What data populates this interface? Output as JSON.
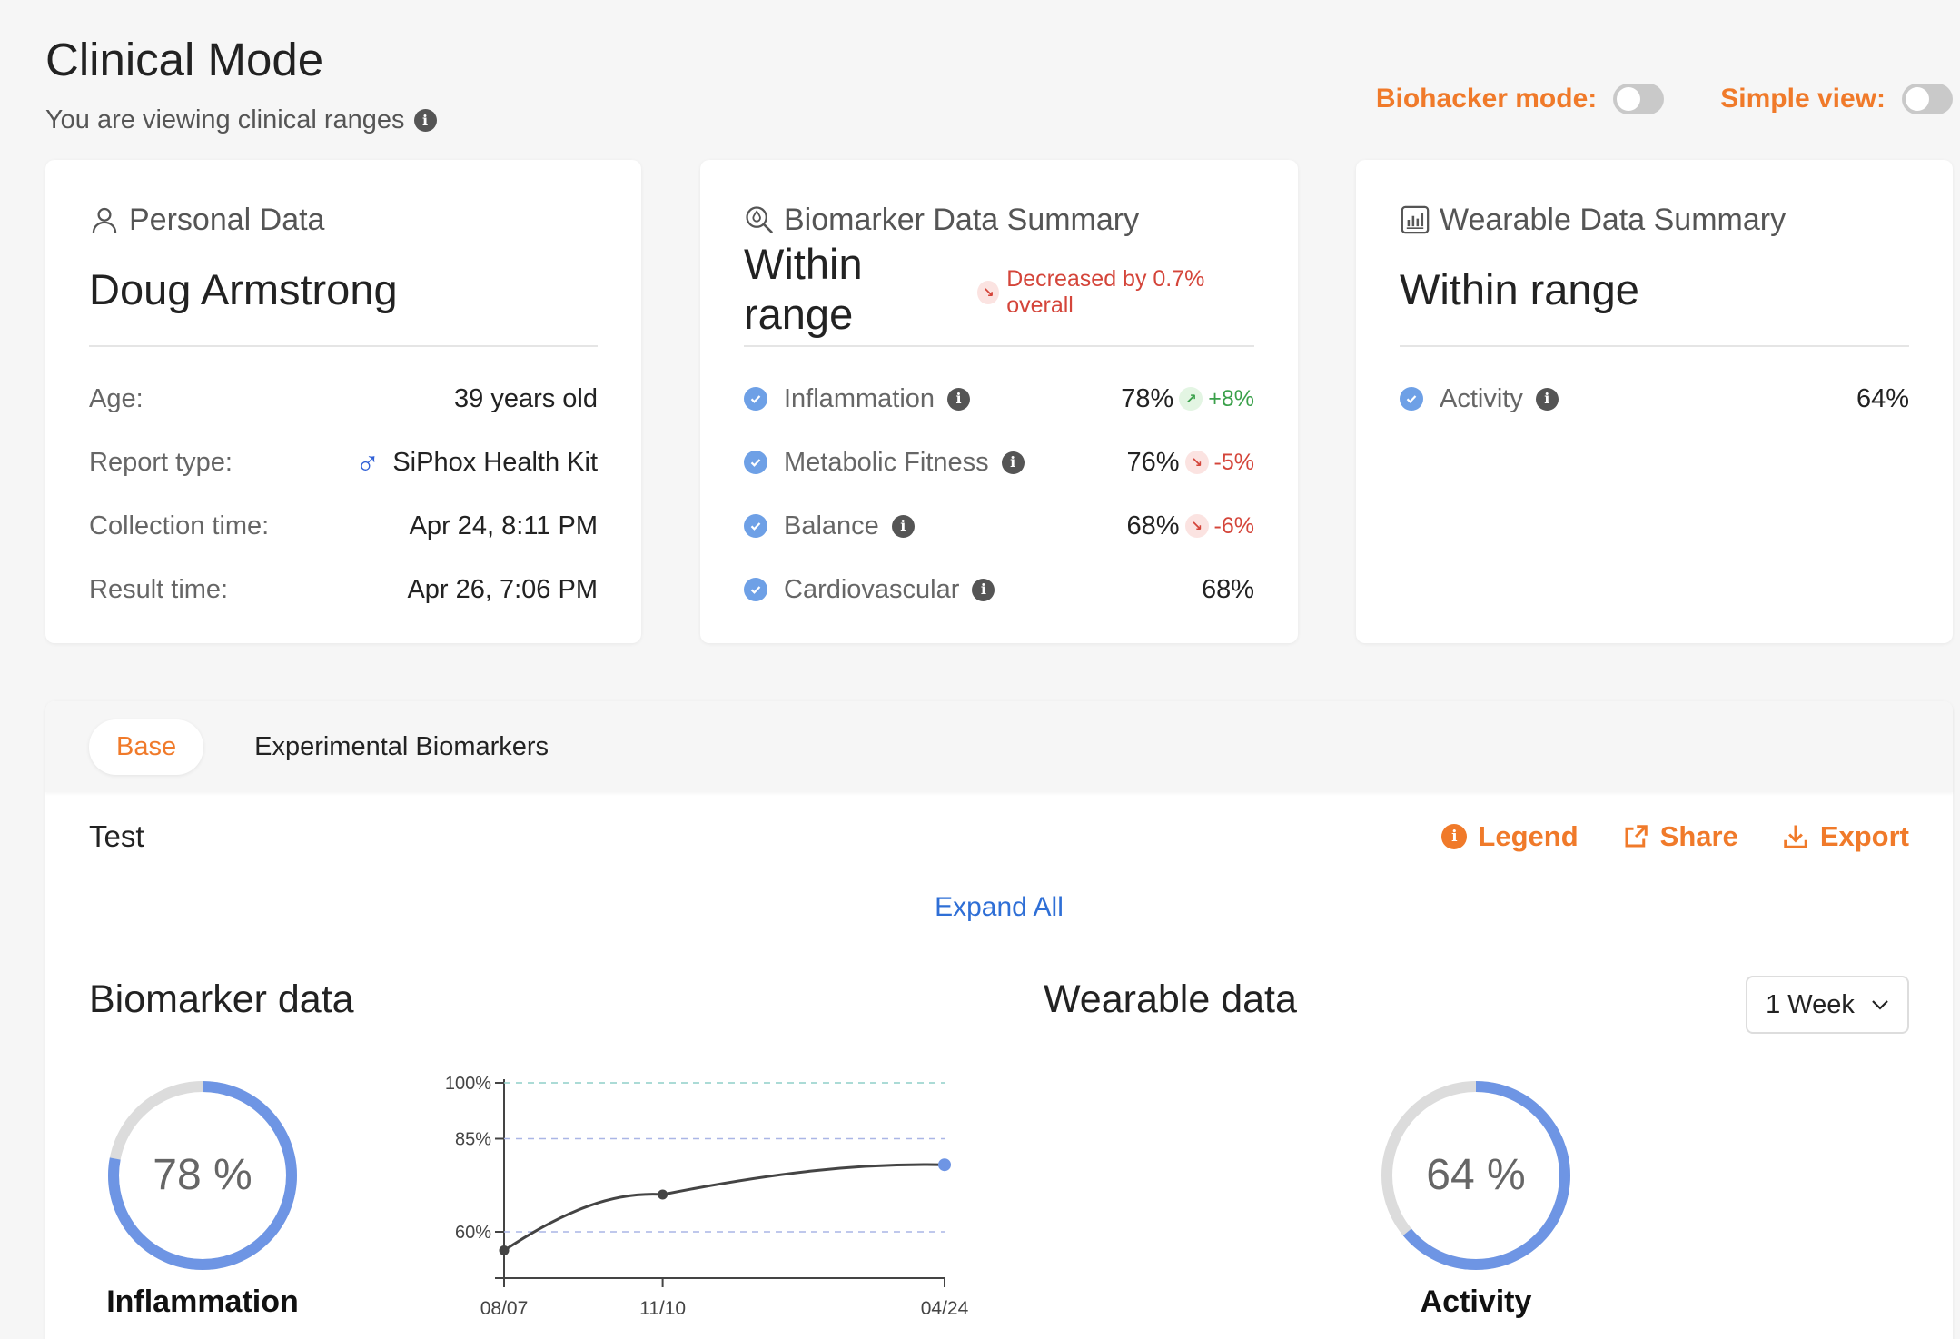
{
  "header": {
    "title": "Clinical Mode",
    "subtitle": "You are viewing clinical ranges",
    "biohacker_label": "Biohacker mode:",
    "simple_label": "Simple view:"
  },
  "personal": {
    "title": "Personal Data",
    "name": "Doug Armstrong",
    "rows": [
      {
        "k": "Age:",
        "v": "39 years old"
      },
      {
        "k": "Report type:",
        "v": "SiPhox Health Kit"
      },
      {
        "k": "Collection time:",
        "v": "Apr 24, 8:11 PM"
      },
      {
        "k": "Result time:",
        "v": "Apr 26, 7:06 PM"
      }
    ]
  },
  "biomarker_summary": {
    "title": "Biomarker Data Summary",
    "status": "Within range",
    "change": "Decreased by 0.7% overall",
    "rows": [
      {
        "k": "Inflammation",
        "v": "78%",
        "delta": "+8%"
      },
      {
        "k": "Metabolic Fitness",
        "v": "76%",
        "delta": "-5%"
      },
      {
        "k": "Balance",
        "v": "68%",
        "delta": "-6%"
      },
      {
        "k": "Cardiovascular",
        "v": "68%"
      }
    ]
  },
  "wearable_summary": {
    "title": "Wearable Data Summary",
    "status": "Within range",
    "rows": [
      {
        "k": "Activity",
        "v": "64%"
      }
    ]
  },
  "tabs": [
    "Base",
    "Experimental Biomarkers"
  ],
  "test": {
    "label": "Test",
    "legend": "Legend",
    "share": "Share",
    "export": "Export",
    "expand_all": "Expand All"
  },
  "biomarker_data": {
    "title": "Biomarker data",
    "ring_value": "78 %",
    "ring_fraction": 0.78,
    "ring_label": "Inflammation"
  },
  "wearable_data": {
    "title": "Wearable data",
    "week": "1 Week",
    "ring_value": "64 %",
    "ring_fraction": 0.64,
    "ring_label": "Activity"
  },
  "chart_data": {
    "type": "line",
    "x": [
      "08/07",
      "11/10",
      "04/24"
    ],
    "x_pos": [
      0,
      0.36,
      1
    ],
    "values": [
      55,
      70,
      78
    ],
    "yticks": [
      "100%",
      "85%",
      "60%"
    ],
    "ytick_values": [
      100,
      85,
      60
    ],
    "ylim": [
      50,
      100
    ],
    "title": "",
    "xlabel": "",
    "ylabel": ""
  },
  "colors": {
    "accent": "#f07a2a",
    "ring_blue": "#6e95e4",
    "ring_gray": "#dcdcdc",
    "link_blue": "#2f6fd6"
  }
}
